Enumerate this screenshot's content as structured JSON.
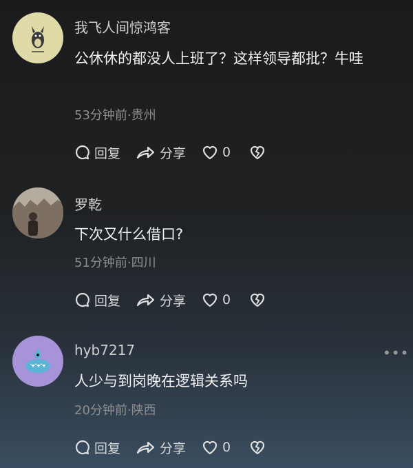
{
  "comments": [
    {
      "username": "我飞人间惊鸿客",
      "text": "公休休的都没人上班了？这样领导都批？牛哇",
      "meta": "53分钟前·贵州",
      "reply": "回复",
      "share": "分享",
      "likes": "0"
    },
    {
      "username": "罗乾",
      "text": "下次又什么借口?",
      "meta": "51分钟前·四川",
      "reply": "回复",
      "share": "分享",
      "likes": "0"
    },
    {
      "username": "hyb7217",
      "text": "人少与到岗晚在逻辑关系吗",
      "meta": "20分钟前·陕西",
      "reply": "回复",
      "share": "分享",
      "likes": "0"
    }
  ],
  "more_icon": "more-dots-icon",
  "colors": {
    "like_icon": "#e8e8e8",
    "meta": "#8d8d8d"
  }
}
